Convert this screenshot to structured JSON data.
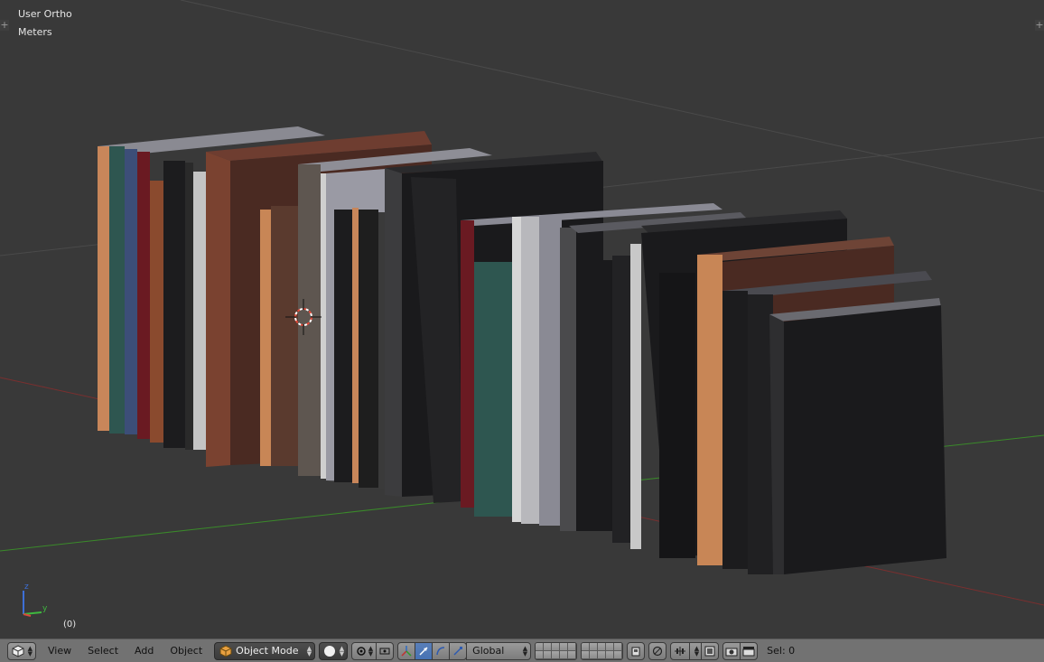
{
  "viewport": {
    "view_name": "User Ortho",
    "units": "Meters",
    "frame": "(0)",
    "corner_plus": "+"
  },
  "gizmo": {
    "z_label": "z",
    "y_label": "y"
  },
  "header": {
    "menus": [
      "View",
      "Select",
      "Add",
      "Object"
    ],
    "mode": "Object Mode",
    "orientation": "Global",
    "status": "Sel: 0"
  },
  "icons": {
    "editor_type": "cube-icon",
    "mode": "orange-cube-icon",
    "shading": "sphere-icon",
    "pivot": "pivot-icon",
    "manipulator": "manipulator-icon",
    "translate": "translate-arrow-icon",
    "rotate": "rotate-arc-icon",
    "scale": "scale-arrow-icon",
    "layers": "layer-grid-icon",
    "lock": "layer-lock-icon",
    "proportional": "proportional-edit-icon",
    "snap": "snap-magnet-icon",
    "snap_element": "snap-element-icon",
    "render": "camera-icon",
    "render_anim": "clapperboard-icon"
  },
  "colors": {
    "viewport_bg": "#393939",
    "header_bg": "#727272",
    "x_axis": "#8b2e2e",
    "y_axis": "#3e8a2e",
    "active_button": "#4672b4"
  }
}
